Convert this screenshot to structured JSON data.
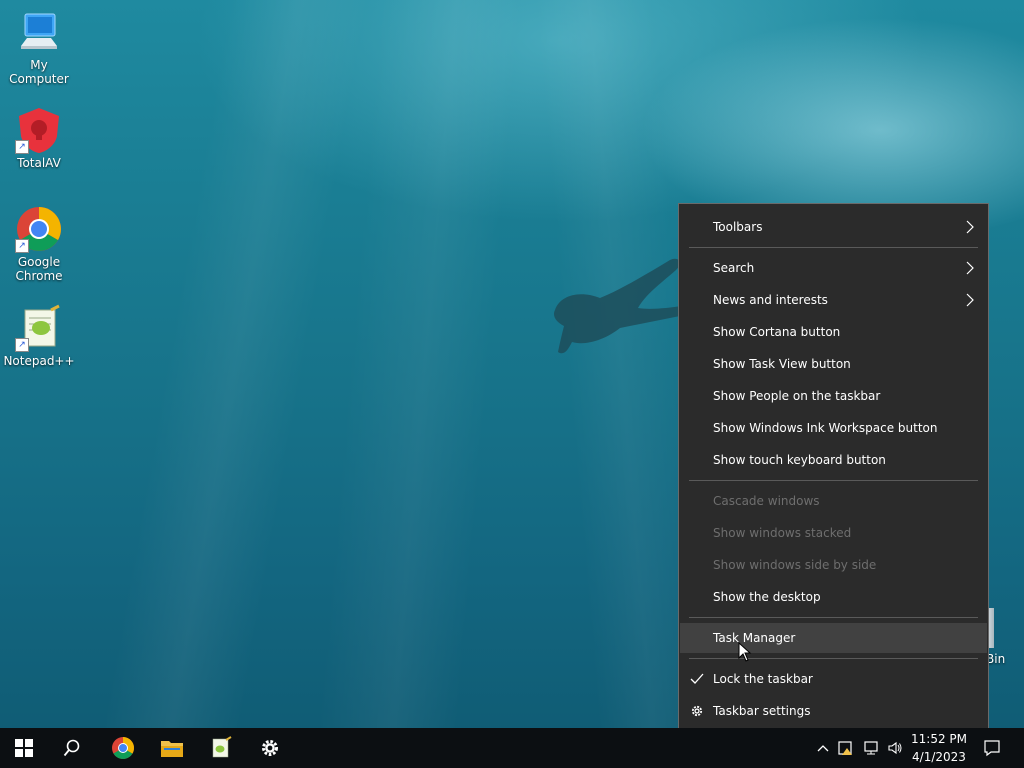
{
  "desktop": {
    "icons": [
      {
        "label": "My Computer",
        "icon": "computer-icon"
      },
      {
        "label": "TotalAV",
        "icon": "totalav-icon"
      },
      {
        "label": "Google Chrome",
        "icon": "chrome-icon"
      },
      {
        "label": "Notepad++",
        "icon": "notepadpp-icon"
      }
    ],
    "recycle_bin_partial_label": "Bin"
  },
  "context_menu": {
    "items": [
      {
        "label": "Toolbars",
        "has_submenu": true,
        "disabled": false
      },
      {
        "label": "Search",
        "has_submenu": true,
        "disabled": false
      },
      {
        "label": "News and interests",
        "has_submenu": true,
        "disabled": false
      },
      {
        "label": "Show Cortana button",
        "has_submenu": false,
        "disabled": false
      },
      {
        "label": "Show Task View button",
        "has_submenu": false,
        "disabled": false
      },
      {
        "label": "Show People on the taskbar",
        "has_submenu": false,
        "disabled": false
      },
      {
        "label": "Show Windows Ink Workspace button",
        "has_submenu": false,
        "disabled": false
      },
      {
        "label": "Show touch keyboard button",
        "has_submenu": false,
        "disabled": false
      },
      {
        "label": "Cascade windows",
        "has_submenu": false,
        "disabled": true
      },
      {
        "label": "Show windows stacked",
        "has_submenu": false,
        "disabled": true
      },
      {
        "label": "Show windows side by side",
        "has_submenu": false,
        "disabled": true
      },
      {
        "label": "Show the desktop",
        "has_submenu": false,
        "disabled": false
      },
      {
        "label": "Task Manager",
        "has_submenu": false,
        "disabled": false,
        "highlighted": true
      },
      {
        "label": "Lock the taskbar",
        "has_submenu": false,
        "disabled": false,
        "checked": true
      },
      {
        "label": "Taskbar settings",
        "has_submenu": false,
        "disabled": false,
        "icon": "gear-icon"
      }
    ]
  },
  "taskbar": {
    "buttons": [
      {
        "name": "start",
        "icon": "windows-icon"
      },
      {
        "name": "search",
        "icon": "search-icon"
      },
      {
        "name": "chrome",
        "icon": "chrome-icon"
      },
      {
        "name": "file-explorer",
        "icon": "folder-icon"
      },
      {
        "name": "notepadpp",
        "icon": "notepadpp-icon"
      },
      {
        "name": "settings",
        "icon": "gear-icon"
      }
    ],
    "tray": {
      "time": "11:52 PM",
      "date": "4/1/2023"
    }
  },
  "colors": {
    "menu_bg": "#2b2b2b",
    "menu_hover": "#414141",
    "menu_disabled_text": "#6e6e6e",
    "taskbar_bg": "#0c0f12"
  }
}
